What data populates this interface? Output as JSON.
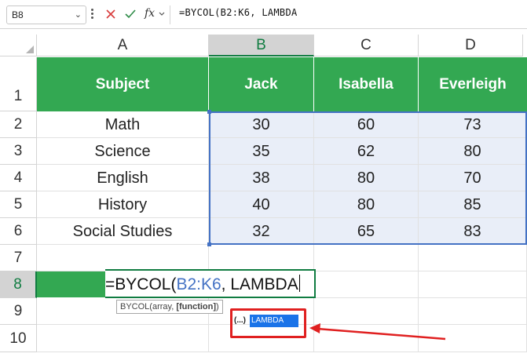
{
  "formula_bar": {
    "name_box": "B8",
    "formula": "=BYCOL(B2:K6, LAMBDA"
  },
  "columns": [
    "A",
    "B",
    "C",
    "D"
  ],
  "rows": [
    "1",
    "2",
    "3",
    "4",
    "5",
    "6",
    "7",
    "8",
    "9",
    "10"
  ],
  "table": {
    "headers": [
      "Subject",
      "Jack",
      "Isabella",
      "Everleigh"
    ],
    "rows": [
      [
        "Math",
        "30",
        "60",
        "73"
      ],
      [
        "Science",
        "35",
        "62",
        "80"
      ],
      [
        "English",
        "38",
        "80",
        "70"
      ],
      [
        "History",
        "40",
        "80",
        "85"
      ],
      [
        "Social Studies",
        "32",
        "65",
        "83"
      ]
    ]
  },
  "editing": {
    "prefix": "=BYCOL(",
    "ref": "B2:K6",
    "suffix": ", LAMBDA"
  },
  "tooltip": {
    "func": "BYCOL(array, ",
    "arg": "[function]",
    "close": ")"
  },
  "autocomplete": {
    "icon": "(...)",
    "item": "LAMBDA"
  },
  "colors": {
    "header_green": "#33a852",
    "selection_blue": "#4472c4",
    "annotation_red": "#e02020"
  },
  "icons": [
    "cancel-icon",
    "check-icon",
    "fx-icon",
    "chevron-down-icon"
  ]
}
